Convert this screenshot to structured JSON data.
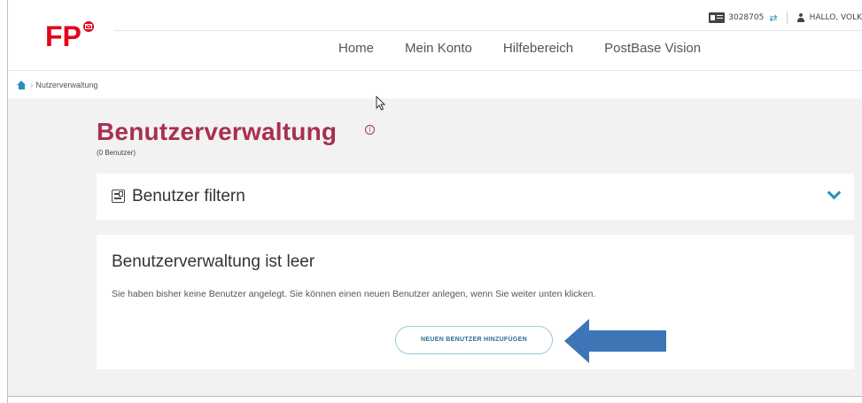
{
  "header": {
    "logo_text": "FP",
    "customer_number": "3028705",
    "greeting": "HALLO, VOLK",
    "nav": [
      "Home",
      "Mein Konto",
      "Hilfebereich",
      "PostBase Vision"
    ]
  },
  "breadcrumb": {
    "current": "Nutzerverwaltung"
  },
  "page": {
    "title": "Benutzerverwaltung",
    "count": "(0 Benutzer)"
  },
  "filter": {
    "title": "Benutzer filtern"
  },
  "empty_state": {
    "title": "Benutzerverwaltung ist leer",
    "text": "Sie haben bisher keine Benutzer angelegt. Sie können einen neuen Benutzer anlegen, wenn Sie weiter unten klicken.",
    "button_label": "NEUEN BENUTZER HINZUFÜGEN"
  },
  "colors": {
    "brand_red": "#e3001b",
    "title": "#a8304f",
    "accent": "#2a8fbd",
    "arrow": "#3d75b6"
  }
}
